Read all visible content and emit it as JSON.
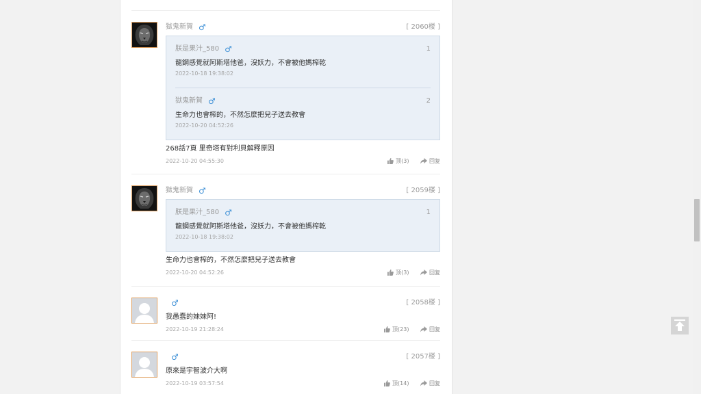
{
  "colors": {
    "accent_male": "#3c8fd6",
    "quote_bg": "#eaf0f7",
    "quote_border": "#cdd9e6",
    "avatar_border": "#e0a060"
  },
  "icons": {
    "male": "male-symbol-icon",
    "like": "thumbs-up-icon",
    "reply": "reply-arrow-icon",
    "back_to_top": "arrow-up-icon"
  },
  "comments": [
    {
      "username": "獄鬼新賀",
      "gender_symbol": "♂",
      "floor": "[ 2060楼 ]",
      "quotes": [
        {
          "username": "朕是果汁_580",
          "gender_symbol": "♂",
          "number": "1",
          "text": "龍鋼感覺就阿斯塔他爸，沒妖力，不會被他媽榨乾",
          "time": "2022-10-18 19:38:02"
        },
        {
          "username": "獄鬼新賀",
          "gender_symbol": "♂",
          "number": "2",
          "text": "生命力也會榨的，不然怎麼把兒子送去教會",
          "time": "2022-10-20 04:52:26"
        }
      ],
      "text": "268話7頁 里奇塔有對利貝解釋原因",
      "time": "2022-10-20 04:55:30",
      "like_label": "顶(3)",
      "reply_label": "回复"
    },
    {
      "username": "獄鬼新賀",
      "gender_symbol": "♂",
      "floor": "[ 2059楼 ]",
      "quotes": [
        {
          "username": "朕是果汁_580",
          "gender_symbol": "♂",
          "number": "1",
          "text": "龍鋼感覺就阿斯塔他爸，沒妖力，不會被他媽榨乾",
          "time": "2022-10-18 19:38:02"
        }
      ],
      "text": "生命力也會榨的，不然怎麼把兒子送去教會",
      "time": "2022-10-20 04:52:26",
      "like_label": "顶(3)",
      "reply_label": "回复"
    },
    {
      "username": "",
      "gender_symbol": "♂",
      "floor": "[ 2058楼 ]",
      "quotes": [],
      "text": "我愚蠢的妹妹阿!",
      "time": "2022-10-19 21:28:24",
      "like_label": "顶(23)",
      "reply_label": "回复"
    },
    {
      "username": "",
      "gender_symbol": "♂",
      "floor": "[ 2057楼 ]",
      "quotes": [],
      "text": "原來是宇智波介大啊",
      "time": "2022-10-19 03:57:54",
      "like_label": "顶(14)",
      "reply_label": "回复"
    }
  ]
}
